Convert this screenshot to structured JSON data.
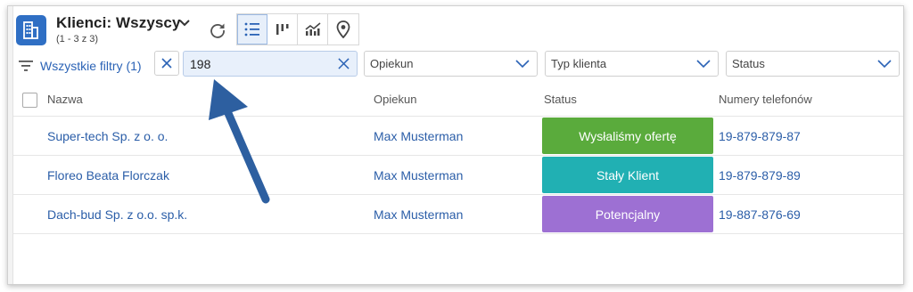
{
  "header": {
    "title": "Klienci: Wszyscy",
    "subtitle": "(1 - 3 z 3)"
  },
  "toolbar": {
    "refresh_icon": "refresh-icon",
    "views": [
      {
        "icon": "list-icon",
        "active": true
      },
      {
        "icon": "pipeline-icon",
        "active": false
      },
      {
        "icon": "chart-icon",
        "active": false
      },
      {
        "icon": "map-pin-icon",
        "active": false
      }
    ]
  },
  "filters": {
    "all_filters_label": "Wszystkie filtry (1)",
    "search_value": "198",
    "selects": [
      {
        "placeholder": "Opiekun"
      },
      {
        "placeholder": "Typ klienta"
      },
      {
        "placeholder": "Status"
      }
    ]
  },
  "table": {
    "columns": [
      "Nazwa",
      "Opiekun",
      "Status",
      "Numery telefonów"
    ],
    "rows": [
      {
        "name": "Super-tech Sp. z o. o.",
        "owner": "Max Musterman",
        "status": "Wysłaliśmy ofertę",
        "status_color": "#5aab3c",
        "phone": "19-879-879-87"
      },
      {
        "name": "Floreo Beata Florczak",
        "owner": "Max Musterman",
        "status": "Stały Klient",
        "status_color": "#21b0b3",
        "phone": "19-879-879-89"
      },
      {
        "name": "Dach-bud Sp. z o.o. sp.k.",
        "owner": "Max Musterman",
        "status": "Potencjalny",
        "status_color": "#9d70d3",
        "phone": "19-887-876-69"
      }
    ]
  },
  "colors": {
    "accent": "#2b63b6",
    "arrow": "#2d5fa0"
  }
}
